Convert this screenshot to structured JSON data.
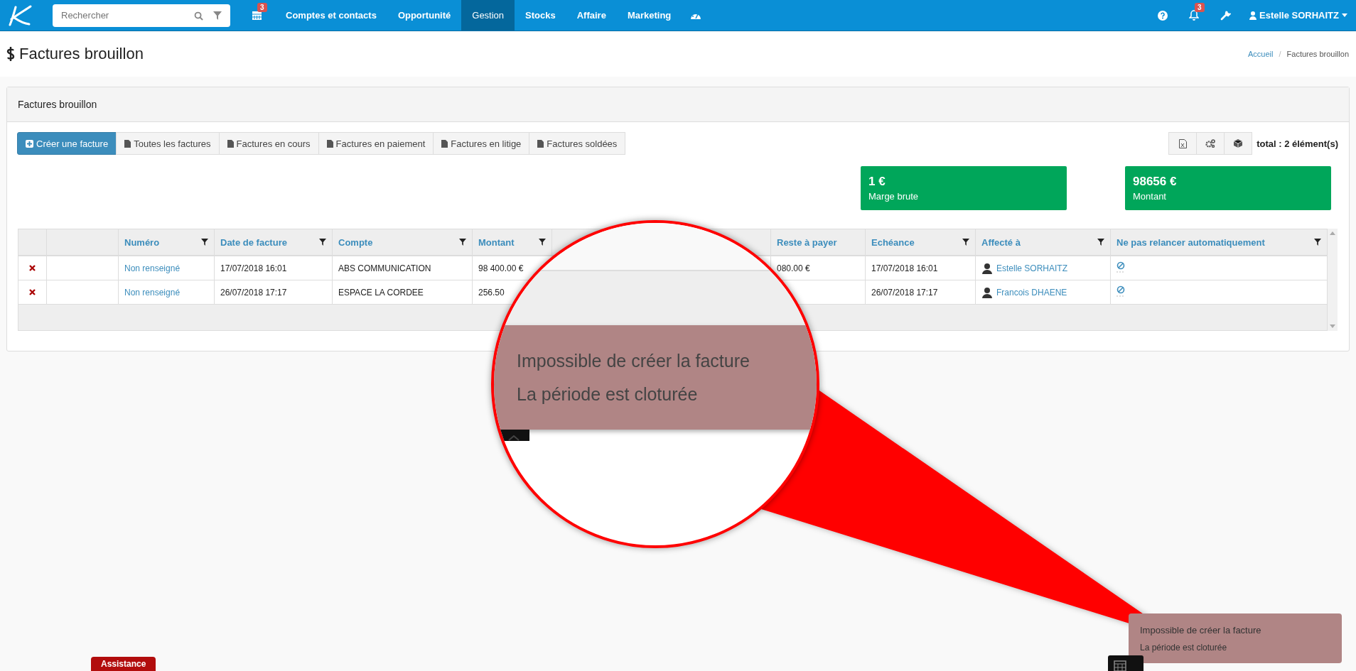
{
  "topbar": {
    "search": {
      "placeholder": "Rechercher"
    },
    "calendar_badge": "3",
    "nav": [
      {
        "label": "Comptes et contacts",
        "selected": false
      },
      {
        "label": "Opportunité",
        "selected": false
      },
      {
        "label": "Gestion",
        "selected": true
      },
      {
        "label": "Stocks",
        "selected": false
      },
      {
        "label": "Affaire",
        "selected": false
      },
      {
        "label": "Marketing",
        "selected": false
      }
    ],
    "notification_badge": "3",
    "user": "Estelle SORHAITZ"
  },
  "page": {
    "title": "Factures brouillon",
    "breadcrumb_separator": "/",
    "breadcrumb": [
      {
        "label": "Accueil",
        "kind": "link"
      },
      {
        "label": "Factures brouillon",
        "kind": "current"
      }
    ]
  },
  "panel": {
    "title": "Factures brouillon",
    "actions": [
      {
        "label": "Créer une facture",
        "kind": "primary"
      },
      {
        "label": "Toutes les factures",
        "kind": "filter"
      },
      {
        "label": "Factures en cours",
        "kind": "filter"
      },
      {
        "label": "Factures en paiement",
        "kind": "filter"
      },
      {
        "label": "Factures en litige",
        "kind": "filter"
      },
      {
        "label": "Factures soldées",
        "kind": "filter"
      }
    ],
    "total": "total : 2 élément(s)",
    "cards": [
      {
        "value": "1 €",
        "label": "Marge brute"
      },
      {
        "value": "98656 €",
        "label": "Montant"
      }
    ],
    "table": {
      "columns": [
        {
          "label": "Numéro",
          "filter": true
        },
        {
          "label": "Date de facture",
          "filter": true
        },
        {
          "label": "Compte",
          "filter": true
        },
        {
          "label": "Montant",
          "filter": true
        },
        {
          "label": "Reste à payer",
          "filter": false
        },
        {
          "label": "Echéance",
          "filter": true
        },
        {
          "label": "Affecté à",
          "filter": true
        },
        {
          "label": "Ne pas relancer automatiquement",
          "filter": true
        }
      ],
      "rows": [
        {
          "numero": "Non renseigné",
          "date": "17/07/2018 16:01",
          "compte": "ABS COMMUNICATION",
          "montant": "98 400.00 €",
          "reste": "080.00 €",
          "echeance": "17/07/2018 16:01",
          "assignee": "Estelle SORHAITZ"
        },
        {
          "numero": "Non renseigné",
          "date": "26/07/2018 17:17",
          "compte": "ESPACE LA CORDEE",
          "montant": "256.50",
          "echeance": "26/07/2018 17:17",
          "assignee": "Francois DHAENE"
        }
      ]
    }
  },
  "magnifier": {
    "title": "Impossible de créer la facture",
    "message": "La période est cloturée"
  },
  "toast": {
    "title": "Impossible de créer la facture",
    "message": "La période est cloturée"
  },
  "assistance": "Assistance"
}
